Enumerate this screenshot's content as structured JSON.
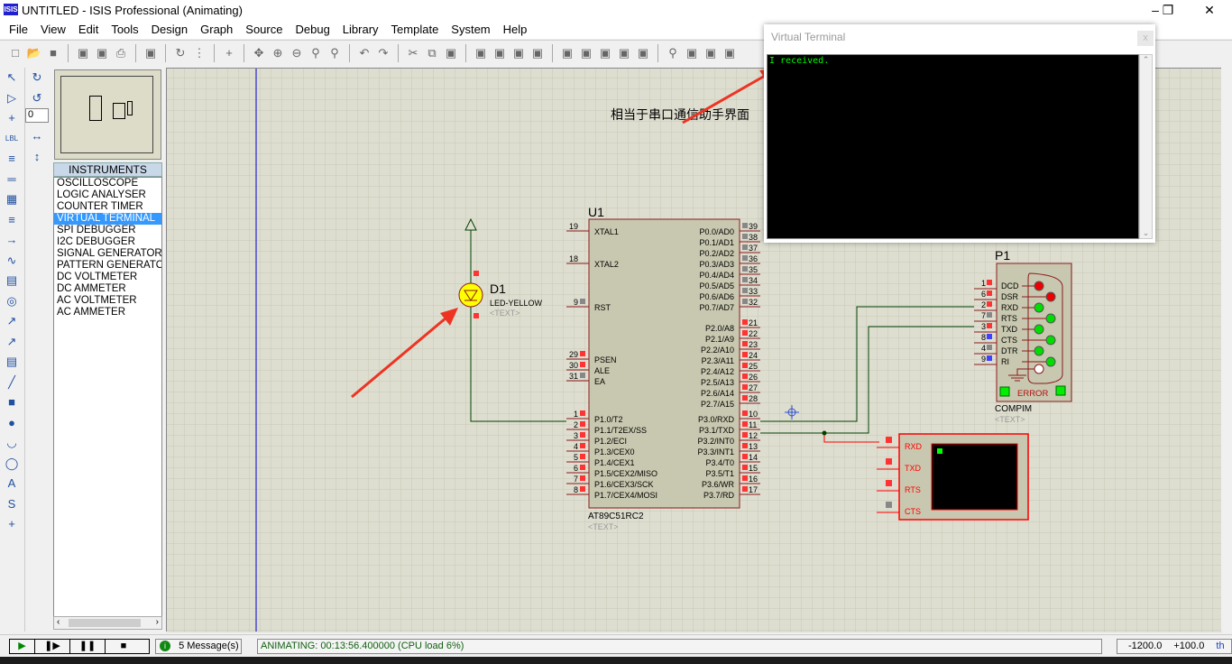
{
  "window": {
    "title": "UNTITLED - ISIS Professional (Animating)",
    "app_icon": "ISIS"
  },
  "menu": [
    "File",
    "View",
    "Edit",
    "Tools",
    "Design",
    "Graph",
    "Source",
    "Debug",
    "Library",
    "Template",
    "System",
    "Help"
  ],
  "toolbar_icons": [
    "new-icon",
    "open-icon",
    "save-icon",
    "import-icon",
    "export-icon",
    "print-icon",
    "area-icon",
    "refresh-icon",
    "grid-icon",
    "origin-icon",
    "pan-icon",
    "zoom-in-icon",
    "zoom-out-icon",
    "zoom-all-icon",
    "zoom-area-icon",
    "undo-icon",
    "redo-icon",
    "cut-icon",
    "copy-icon",
    "paste-icon",
    "block-copy-icon",
    "block-move-icon",
    "block-rotate-icon",
    "block-delete-icon",
    "pick-icon",
    "make-device-icon",
    "package-icon",
    "decompose-icon",
    "wire-autorouter-icon",
    "search-icon",
    "property-icon",
    "netlist-icon",
    "bom-icon"
  ],
  "left_panel": {
    "rotation_value": "0",
    "header": "INSTRUMENTS",
    "items": [
      "OSCILLOSCOPE",
      "LOGIC ANALYSER",
      "COUNTER TIMER",
      "VIRTUAL TERMINAL",
      "SPI DEBUGGER",
      "I2C DEBUGGER",
      "SIGNAL GENERATOR",
      "PATTERN GENERATOR",
      "DC VOLTMETER",
      "DC AMMETER",
      "AC VOLTMETER",
      "AC AMMETER"
    ],
    "selected": "VIRTUAL TERMINAL"
  },
  "schematic": {
    "annotation": "相当于串口通信助手界面",
    "led": {
      "ref": "D1",
      "value": "LED-YELLOW",
      "text": "<TEXT>"
    },
    "mcu": {
      "ref": "U1",
      "part": "AT89C51RC2",
      "text": "<TEXT>",
      "left_pins": [
        {
          "num": "19",
          "label": "XTAL1"
        },
        {
          "num": "18",
          "label": "XTAL2"
        },
        {
          "num": "9",
          "label": "RST"
        },
        {
          "num": "29",
          "label": "PSEN"
        },
        {
          "num": "30",
          "label": "ALE"
        },
        {
          "num": "31",
          "label": "EA"
        },
        {
          "num": "1",
          "label": "P1.0/T2"
        },
        {
          "num": "2",
          "label": "P1.1/T2EX/SS"
        },
        {
          "num": "3",
          "label": "P1.2/ECI"
        },
        {
          "num": "4",
          "label": "P1.3/CEX0"
        },
        {
          "num": "5",
          "label": "P1.4/CEX1"
        },
        {
          "num": "6",
          "label": "P1.5/CEX2/MISO"
        },
        {
          "num": "7",
          "label": "P1.6/CEX3/SCK"
        },
        {
          "num": "8",
          "label": "P1.7/CEX4/MOSI"
        }
      ],
      "right_pins": [
        {
          "num": "39",
          "label": "P0.0/AD0"
        },
        {
          "num": "38",
          "label": "P0.1/AD1"
        },
        {
          "num": "37",
          "label": "P0.2/AD2"
        },
        {
          "num": "36",
          "label": "P0.3/AD3"
        },
        {
          "num": "35",
          "label": "P0.4/AD4"
        },
        {
          "num": "34",
          "label": "P0.5/AD5"
        },
        {
          "num": "33",
          "label": "P0.6/AD6"
        },
        {
          "num": "32",
          "label": "P0.7/AD7"
        },
        {
          "num": "21",
          "label": "P2.0/A8"
        },
        {
          "num": "22",
          "label": "P2.1/A9"
        },
        {
          "num": "23",
          "label": "P2.2/A10"
        },
        {
          "num": "24",
          "label": "P2.3/A11"
        },
        {
          "num": "25",
          "label": "P2.4/A12"
        },
        {
          "num": "26",
          "label": "P2.5/A13"
        },
        {
          "num": "27",
          "label": "P2.6/A14"
        },
        {
          "num": "28",
          "label": "P2.7/A15"
        },
        {
          "num": "10",
          "label": "P3.0/RXD"
        },
        {
          "num": "11",
          "label": "P3.1/TXD"
        },
        {
          "num": "12",
          "label": "P3.2/INT0"
        },
        {
          "num": "13",
          "label": "P3.3/INT1"
        },
        {
          "num": "14",
          "label": "P3.4/T0"
        },
        {
          "num": "15",
          "label": "P3.5/T1"
        },
        {
          "num": "16",
          "label": "P3.6/WR"
        },
        {
          "num": "17",
          "label": "P3.7/RD"
        }
      ]
    },
    "compim": {
      "ref": "P1",
      "part": "COMPIM",
      "text": "<TEXT>",
      "error_label": "ERROR",
      "pins": [
        {
          "num": "1",
          "label": "DCD"
        },
        {
          "num": "6",
          "label": "DSR"
        },
        {
          "num": "2",
          "label": "RXD"
        },
        {
          "num": "7",
          "label": "RTS"
        },
        {
          "num": "3",
          "label": "TXD"
        },
        {
          "num": "8",
          "label": "CTS"
        },
        {
          "num": "4",
          "label": "DTR"
        },
        {
          "num": "9",
          "label": "RI"
        }
      ]
    },
    "terminal_component": {
      "pins": [
        "RXD",
        "TXD",
        "RTS",
        "CTS"
      ]
    }
  },
  "virtual_terminal": {
    "title": "Virtual Terminal",
    "close": "x",
    "output": "I received."
  },
  "status": {
    "messages": "5 Message(s)",
    "animating": "ANIMATING: 00:13:56.400000 (CPU load 6%)",
    "coord_x": "-1200.0",
    "coord_y": "+100.0",
    "units": "th"
  },
  "colors": {
    "canvas": "#deded0",
    "wire": "#004000",
    "component_body": "#c8c8b0",
    "terminal_text": "#00ff00",
    "annotation_arrow": "#ee3322"
  }
}
